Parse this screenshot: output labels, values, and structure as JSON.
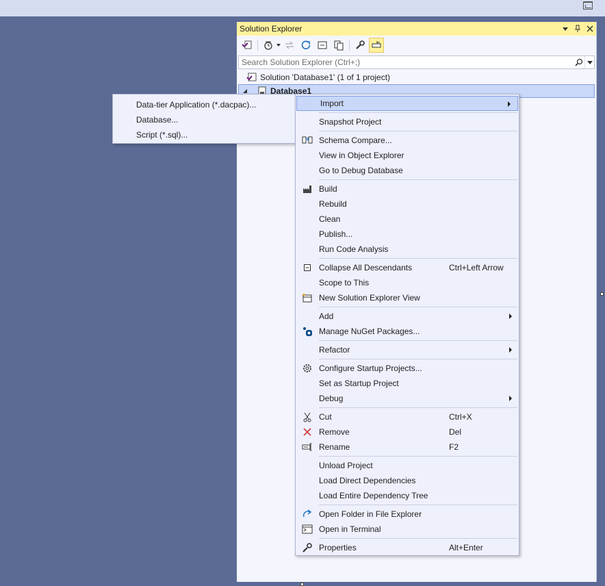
{
  "solution_explorer": {
    "title": "Solution Explorer",
    "search_placeholder": "Search Solution Explorer (Ctrl+;)",
    "tree": {
      "solution_label": "Solution 'Database1' (1 of 1 project)",
      "project_label": "Database1"
    }
  },
  "import_submenu": {
    "items": [
      {
        "label": "Data-tier Application (*.dacpac)..."
      },
      {
        "label": "Database..."
      },
      {
        "label": "Script (*.sql)..."
      }
    ]
  },
  "context_menu": {
    "items": [
      {
        "label": "Import",
        "shortcut": "",
        "submenu": true,
        "icon": "",
        "highlighted": true
      },
      {
        "sep": true
      },
      {
        "label": "Snapshot Project",
        "shortcut": "",
        "icon": ""
      },
      {
        "sep": true
      },
      {
        "label": "Schema Compare...",
        "shortcut": "",
        "icon": "schema-compare-icon"
      },
      {
        "label": "View in Object Explorer",
        "shortcut": "",
        "icon": ""
      },
      {
        "label": "Go to Debug Database",
        "shortcut": "",
        "icon": ""
      },
      {
        "sep": true
      },
      {
        "label": "Build",
        "shortcut": "",
        "icon": "build-icon"
      },
      {
        "label": "Rebuild",
        "shortcut": "",
        "icon": ""
      },
      {
        "label": "Clean",
        "shortcut": "",
        "icon": ""
      },
      {
        "label": "Publish...",
        "shortcut": "",
        "icon": ""
      },
      {
        "label": "Run Code Analysis",
        "shortcut": "",
        "icon": ""
      },
      {
        "sep": true
      },
      {
        "label": "Collapse All Descendants",
        "shortcut": "Ctrl+Left Arrow",
        "icon": "collapse-icon"
      },
      {
        "label": "Scope to This",
        "shortcut": "",
        "icon": ""
      },
      {
        "label": "New Solution Explorer View",
        "shortcut": "",
        "icon": "new-view-icon"
      },
      {
        "sep": true
      },
      {
        "label": "Add",
        "shortcut": "",
        "submenu": true,
        "icon": ""
      },
      {
        "label": "Manage NuGet Packages...",
        "shortcut": "",
        "icon": "nuget-icon"
      },
      {
        "sep": true
      },
      {
        "label": "Refactor",
        "shortcut": "",
        "submenu": true,
        "icon": ""
      },
      {
        "sep": true
      },
      {
        "label": "Configure Startup Projects...",
        "shortcut": "",
        "icon": "gear-icon"
      },
      {
        "label": "Set as Startup Project",
        "shortcut": "",
        "icon": ""
      },
      {
        "label": "Debug",
        "shortcut": "",
        "submenu": true,
        "icon": ""
      },
      {
        "sep": true
      },
      {
        "label": "Cut",
        "shortcut": "Ctrl+X",
        "icon": "scissors-icon"
      },
      {
        "label": "Remove",
        "shortcut": "Del",
        "icon": "remove-icon"
      },
      {
        "label": "Rename",
        "shortcut": "F2",
        "icon": "rename-icon"
      },
      {
        "sep": true
      },
      {
        "label": "Unload Project",
        "shortcut": "",
        "icon": ""
      },
      {
        "label": "Load Direct Dependencies",
        "shortcut": "",
        "icon": ""
      },
      {
        "label": "Load Entire Dependency Tree",
        "shortcut": "",
        "icon": ""
      },
      {
        "sep": true
      },
      {
        "label": "Open Folder in File Explorer",
        "shortcut": "",
        "icon": "open-folder-icon"
      },
      {
        "label": "Open in Terminal",
        "shortcut": "",
        "icon": "terminal-icon"
      },
      {
        "sep": true
      },
      {
        "label": "Properties",
        "shortcut": "Alt+Enter",
        "icon": "wrench-icon"
      }
    ]
  }
}
